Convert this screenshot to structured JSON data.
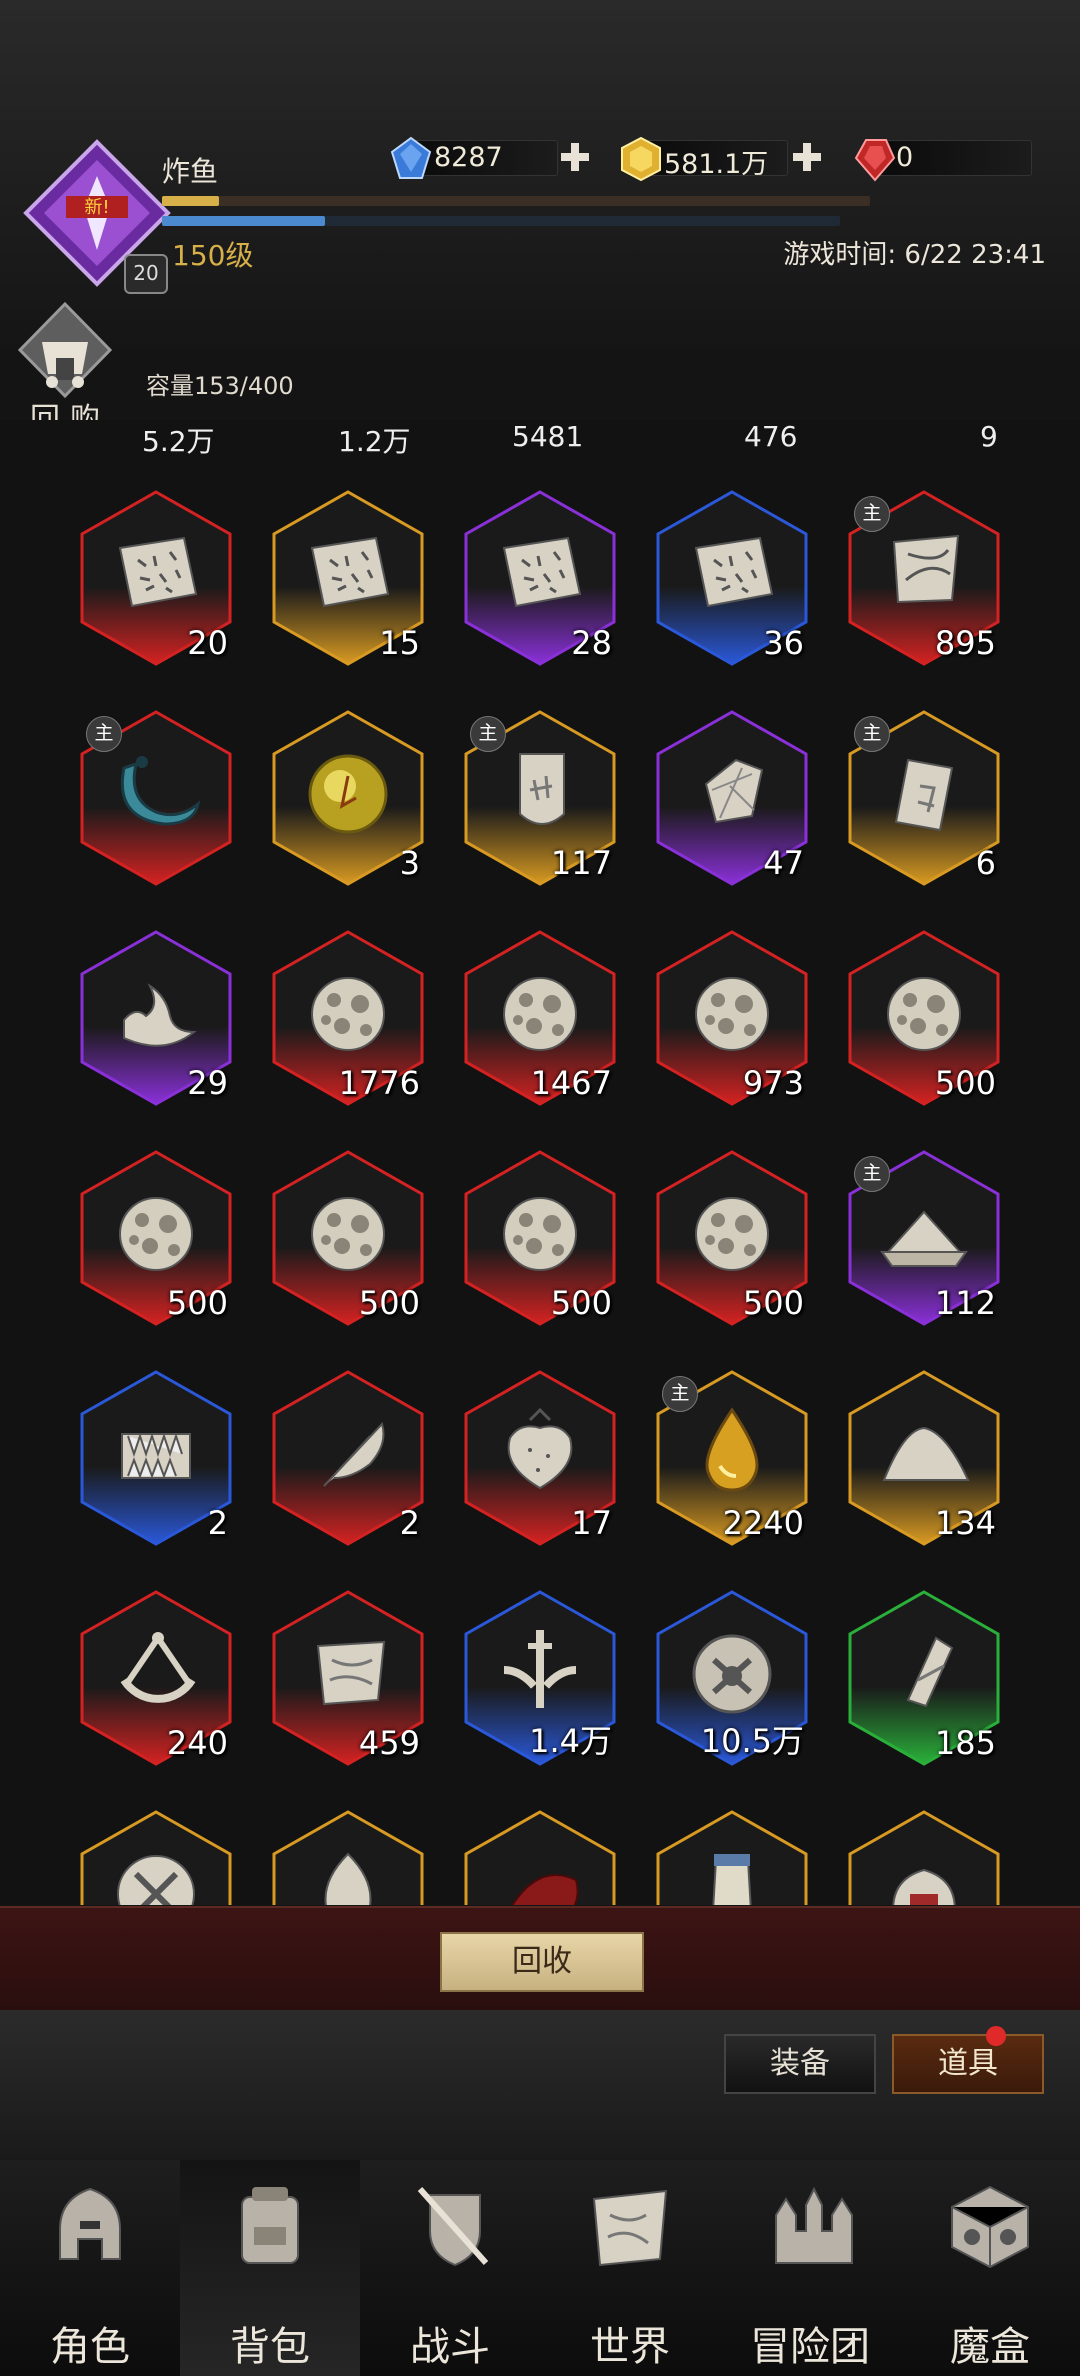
{
  "player": {
    "name": "炸鱼",
    "new_badge": "新!",
    "avatar_level": "20",
    "level": "150级"
  },
  "game_time": "游戏时间: 6/22 23:41",
  "currencies": [
    {
      "name": "blue-gem",
      "value": "8287",
      "has_plus": true,
      "color": "#3a7ad8"
    },
    {
      "name": "gold-coin",
      "value": "581.1万",
      "has_plus": true,
      "color": "#e0b030"
    },
    {
      "name": "red-gem",
      "value": "0",
      "has_plus": false,
      "color": "#c02828"
    }
  ],
  "recycle_top_label": "回购",
  "capacity": "容量153/400",
  "partial_row_counts": [
    "5.2万",
    "1.2万",
    "5481",
    "476",
    "9"
  ],
  "items": [
    {
      "icon": "rune-stone-icon",
      "count": "20",
      "rarity": "red",
      "main": false
    },
    {
      "icon": "rune-stone-icon",
      "count": "15",
      "rarity": "gold",
      "main": false
    },
    {
      "icon": "rune-stone-icon",
      "count": "28",
      "rarity": "purple",
      "main": false
    },
    {
      "icon": "rune-stone-icon",
      "count": "36",
      "rarity": "blue",
      "main": false
    },
    {
      "icon": "torn-scroll-icon",
      "count": "895",
      "rarity": "red",
      "main": true
    },
    {
      "icon": "dark-crescent-icon",
      "count": "",
      "rarity": "red",
      "main": true
    },
    {
      "icon": "amber-orb-icon",
      "count": "3",
      "rarity": "gold",
      "main": false
    },
    {
      "icon": "stone-tablet-icon",
      "count": "117",
      "rarity": "gold",
      "main": true
    },
    {
      "icon": "crystal-shard-icon",
      "count": "47",
      "rarity": "purple",
      "main": false
    },
    {
      "icon": "talisman-card-icon",
      "count": "6",
      "rarity": "gold",
      "main": true
    },
    {
      "icon": "spirit-flame-icon",
      "count": "29",
      "rarity": "purple",
      "main": false
    },
    {
      "icon": "meteorite-icon",
      "count": "1776",
      "rarity": "red",
      "main": false
    },
    {
      "icon": "meteorite-icon",
      "count": "1467",
      "rarity": "red",
      "main": false
    },
    {
      "icon": "meteorite-icon",
      "count": "973",
      "rarity": "red",
      "main": false
    },
    {
      "icon": "meteorite-icon",
      "count": "500",
      "rarity": "red",
      "main": false
    },
    {
      "icon": "meteorite-icon",
      "count": "500",
      "rarity": "red",
      "main": false
    },
    {
      "icon": "meteorite-icon",
      "count": "500",
      "rarity": "red",
      "main": false
    },
    {
      "icon": "meteorite-icon",
      "count": "500",
      "rarity": "red",
      "main": false
    },
    {
      "icon": "meteorite-icon",
      "count": "500",
      "rarity": "red",
      "main": false
    },
    {
      "icon": "sand-tray-icon",
      "count": "112",
      "rarity": "purple",
      "main": true
    },
    {
      "icon": "fang-jaw-icon",
      "count": "2",
      "rarity": "blue",
      "main": false
    },
    {
      "icon": "feather-icon",
      "count": "2",
      "rarity": "red",
      "main": false
    },
    {
      "icon": "strawberry-icon",
      "count": "17",
      "rarity": "red",
      "main": false
    },
    {
      "icon": "golden-drop-icon",
      "count": "2240",
      "rarity": "gold",
      "main": true
    },
    {
      "icon": "powder-pile-icon",
      "count": "134",
      "rarity": "gold",
      "main": false
    },
    {
      "icon": "sextant-icon",
      "count": "240",
      "rarity": "red",
      "main": false
    },
    {
      "icon": "map-scroll-icon",
      "count": "459",
      "rarity": "red",
      "main": false
    },
    {
      "icon": "winged-sword-icon",
      "count": "1.4万",
      "rarity": "blue",
      "main": false
    },
    {
      "icon": "forge-emblem-icon",
      "count": "10.5万",
      "rarity": "blue",
      "main": false
    },
    {
      "icon": "bone-shard-icon",
      "count": "185",
      "rarity": "green",
      "main": false
    },
    {
      "icon": "crossed-tools-icon",
      "count": "",
      "rarity": "gold",
      "main": false
    },
    {
      "icon": "flame-icon",
      "count": "",
      "rarity": "gold",
      "main": false
    },
    {
      "icon": "red-cloth-icon",
      "count": "",
      "rarity": "gold",
      "main": false
    },
    {
      "icon": "horn-icon",
      "count": "",
      "rarity": "gold",
      "main": false
    },
    {
      "icon": "pouch-icon",
      "count": "",
      "rarity": "gold",
      "main": false
    }
  ],
  "main_badge": "主",
  "recycle_button": "回收",
  "category_tabs": {
    "equip": "装备",
    "items": "道具"
  },
  "nav": [
    {
      "label": "角色",
      "icon": "helmet-icon"
    },
    {
      "label": "背包",
      "icon": "backpack-icon"
    },
    {
      "label": "战斗",
      "icon": "shield-sword-icon"
    },
    {
      "label": "世界",
      "icon": "world-map-icon"
    },
    {
      "label": "冒险团",
      "icon": "castle-icon"
    },
    {
      "label": "魔盒",
      "icon": "magic-cube-icon"
    }
  ],
  "active_nav": "背包",
  "rarity_colors": {
    "red": "#d42222",
    "gold": "#d89a22",
    "purple": "#8a30d8",
    "blue": "#2a58d8",
    "green": "#2ab03a"
  }
}
